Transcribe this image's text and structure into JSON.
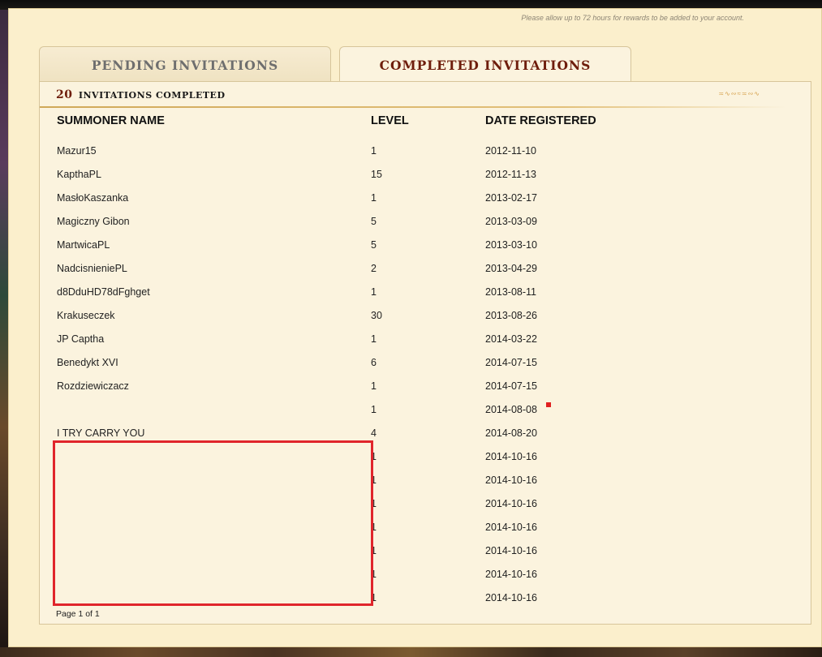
{
  "header": {
    "note": "Please allow up to 72 hours for rewards to be added to your account."
  },
  "tabs": [
    {
      "label": "PENDING INVITATIONS",
      "active": false
    },
    {
      "label": "COMPLETED INVITATIONS",
      "active": true
    }
  ],
  "summary": {
    "count": "20",
    "label": "INVITATIONS COMPLETED"
  },
  "table": {
    "headers": {
      "name": "SUMMONER NAME",
      "level": "LEVEL",
      "date": "DATE REGISTERED"
    },
    "rows": [
      {
        "name": "Mazur15",
        "level": "1",
        "date": "2012-11-10"
      },
      {
        "name": "KapthaPL",
        "level": "15",
        "date": "2012-11-13"
      },
      {
        "name": "MasłoKaszanka",
        "level": "1",
        "date": "2013-02-17"
      },
      {
        "name": "Magiczny Gibon",
        "level": "5",
        "date": "2013-03-09"
      },
      {
        "name": "MartwicaPL",
        "level": "5",
        "date": "2013-03-10"
      },
      {
        "name": "NadcisnieniePL",
        "level": "2",
        "date": "2013-04-29"
      },
      {
        "name": "d8DduHD78dFghget",
        "level": "1",
        "date": "2013-08-11"
      },
      {
        "name": "Krakuseczek",
        "level": "30",
        "date": "2013-08-26"
      },
      {
        "name": "JP Captha",
        "level": "1",
        "date": "2014-03-22"
      },
      {
        "name": "Benedykt XVI",
        "level": "6",
        "date": "2014-07-15"
      },
      {
        "name": "Rozdziewiczacz",
        "level": "1",
        "date": "2014-07-15"
      },
      {
        "name": "",
        "level": "1",
        "date": "2014-08-08"
      },
      {
        "name": "I TRY CARRY YOU",
        "level": "4",
        "date": "2014-08-20"
      },
      {
        "name": "",
        "level": "1",
        "date": "2014-10-16"
      },
      {
        "name": "",
        "level": "1",
        "date": "2014-10-16"
      },
      {
        "name": "",
        "level": "1",
        "date": "2014-10-16"
      },
      {
        "name": "",
        "level": "1",
        "date": "2014-10-16"
      },
      {
        "name": "",
        "level": "1",
        "date": "2014-10-16"
      },
      {
        "name": "",
        "level": "1",
        "date": "2014-10-16"
      },
      {
        "name": "",
        "level": "1",
        "date": "2014-10-16"
      }
    ]
  },
  "pagination": "Page 1 of 1",
  "colors": {
    "panel_bg": "#fbefcc",
    "active_tab_text": "#6e1d0b",
    "inactive_tab_text": "#6e6e6e",
    "highlight_box": "#e0252b",
    "marker": "#e02020"
  }
}
